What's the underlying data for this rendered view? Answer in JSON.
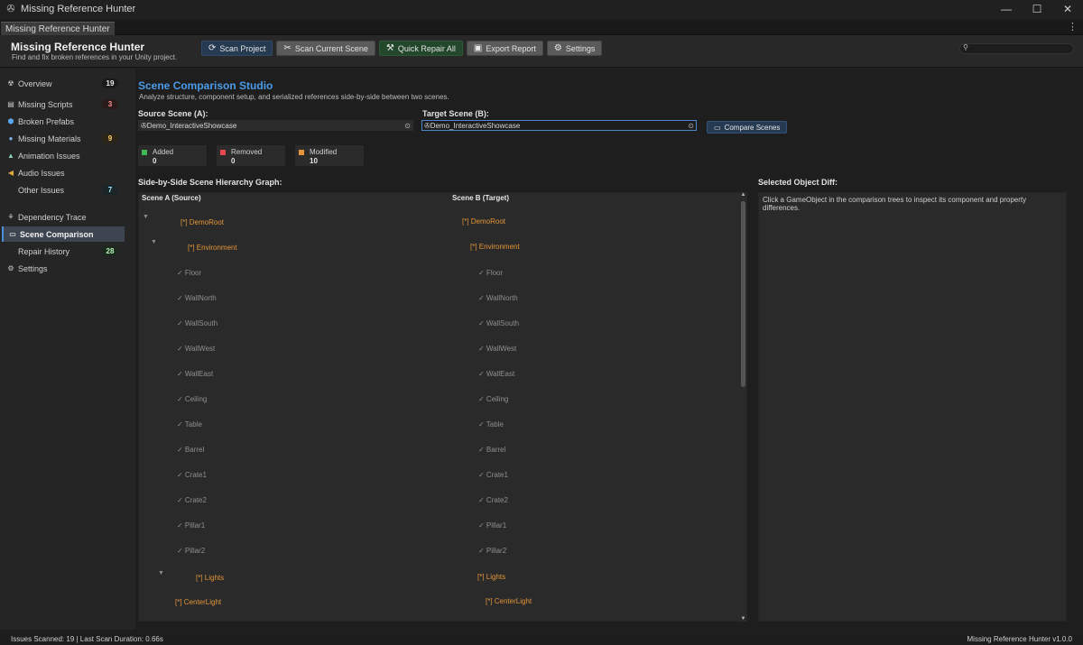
{
  "window": {
    "title": "Missing Reference Hunter",
    "tab": "Missing Reference Hunter"
  },
  "header": {
    "title": "Missing Reference Hunter",
    "subtitle": "Find and fix broken references in your Unity project.",
    "search_placeholder": ""
  },
  "toolbar": {
    "scan_project": "Scan Project",
    "scan_current_scene": "Scan Current Scene",
    "quick_repair_all": "Quick Repair All",
    "export_report": "Export Report",
    "settings": "Settings"
  },
  "sidebar": {
    "items": [
      {
        "label": "Overview",
        "badge": "19",
        "icon": "radiation-icon"
      },
      {
        "label": "Missing Scripts",
        "badge": "3",
        "icon": "script-icon"
      },
      {
        "label": "Broken Prefabs",
        "badge": "",
        "icon": "prefab-icon"
      },
      {
        "label": "Missing Materials",
        "badge": "9",
        "icon": "material-icon"
      },
      {
        "label": "Animation Issues",
        "badge": "",
        "icon": "animation-icon"
      },
      {
        "label": "Audio Issues",
        "badge": "",
        "icon": "audio-icon"
      },
      {
        "label": "Other Issues",
        "badge": "7",
        "icon": ""
      },
      {
        "label": "Dependency Trace",
        "badge": "",
        "icon": "dependency-icon"
      },
      {
        "label": "Scene Comparison",
        "badge": "",
        "icon": "scene-icon"
      },
      {
        "label": "Repair History",
        "badge": "28",
        "icon": ""
      },
      {
        "label": "Settings",
        "badge": "",
        "icon": "gear-icon"
      }
    ]
  },
  "main": {
    "title": "Scene Comparison Studio",
    "subtitle": "Analyze structure, component setup, and serialized references side-by-side between two scenes.",
    "source_label": "Source Scene (A):",
    "source_value": "Demo_InteractiveShowcase",
    "target_label": "Target Scene (B):",
    "target_value": "Demo_InteractiveShowcase",
    "compare_button": "Compare Scenes",
    "stats": [
      {
        "label": "Added",
        "value": "0",
        "color": "#3fb950"
      },
      {
        "label": "Removed",
        "value": "0",
        "color": "#e5484d"
      },
      {
        "label": "Modified",
        "value": "10",
        "color": "#e39538"
      }
    ],
    "graph_label": "Side-by-Side Scene Hierarchy Graph:",
    "scene_a_header": "Scene A (Source)",
    "scene_b_header": "Scene B (Target)",
    "nodes": [
      {
        "label": "[*] DemoRoot",
        "kind": "group"
      },
      {
        "label": "[*] Environment",
        "kind": "group"
      },
      {
        "label": "✓ Floor",
        "kind": "leaf"
      },
      {
        "label": "✓ WallNorth",
        "kind": "leaf"
      },
      {
        "label": "✓ WallSouth",
        "kind": "leaf"
      },
      {
        "label": "✓ WallWest",
        "kind": "leaf"
      },
      {
        "label": "✓ WallEast",
        "kind": "leaf"
      },
      {
        "label": "✓ Ceiling",
        "kind": "leaf"
      },
      {
        "label": "✓ Table",
        "kind": "leaf"
      },
      {
        "label": "✓ Barrel",
        "kind": "leaf"
      },
      {
        "label": "✓ Crate1",
        "kind": "leaf"
      },
      {
        "label": "✓ Crate2",
        "kind": "leaf"
      },
      {
        "label": "✓ Pillar1",
        "kind": "leaf"
      },
      {
        "label": "✓ Pillar2",
        "kind": "leaf"
      },
      {
        "label": "[*] Lights",
        "kind": "group"
      },
      {
        "label": "[*] CenterLight",
        "kind": "group"
      }
    ],
    "diff_label": "Selected Object Diff:",
    "diff_hint": "Click a GameObject in the comparison trees to inspect its component and property differences."
  },
  "status": {
    "left": "Issues Scanned: 19 | Last Scan Duration: 0.66s",
    "right": "Missing Reference Hunter v1.0.0"
  },
  "colors": {
    "accent": "#4c9be8",
    "modified": "#e39538",
    "active_bg": "#3d4551"
  }
}
